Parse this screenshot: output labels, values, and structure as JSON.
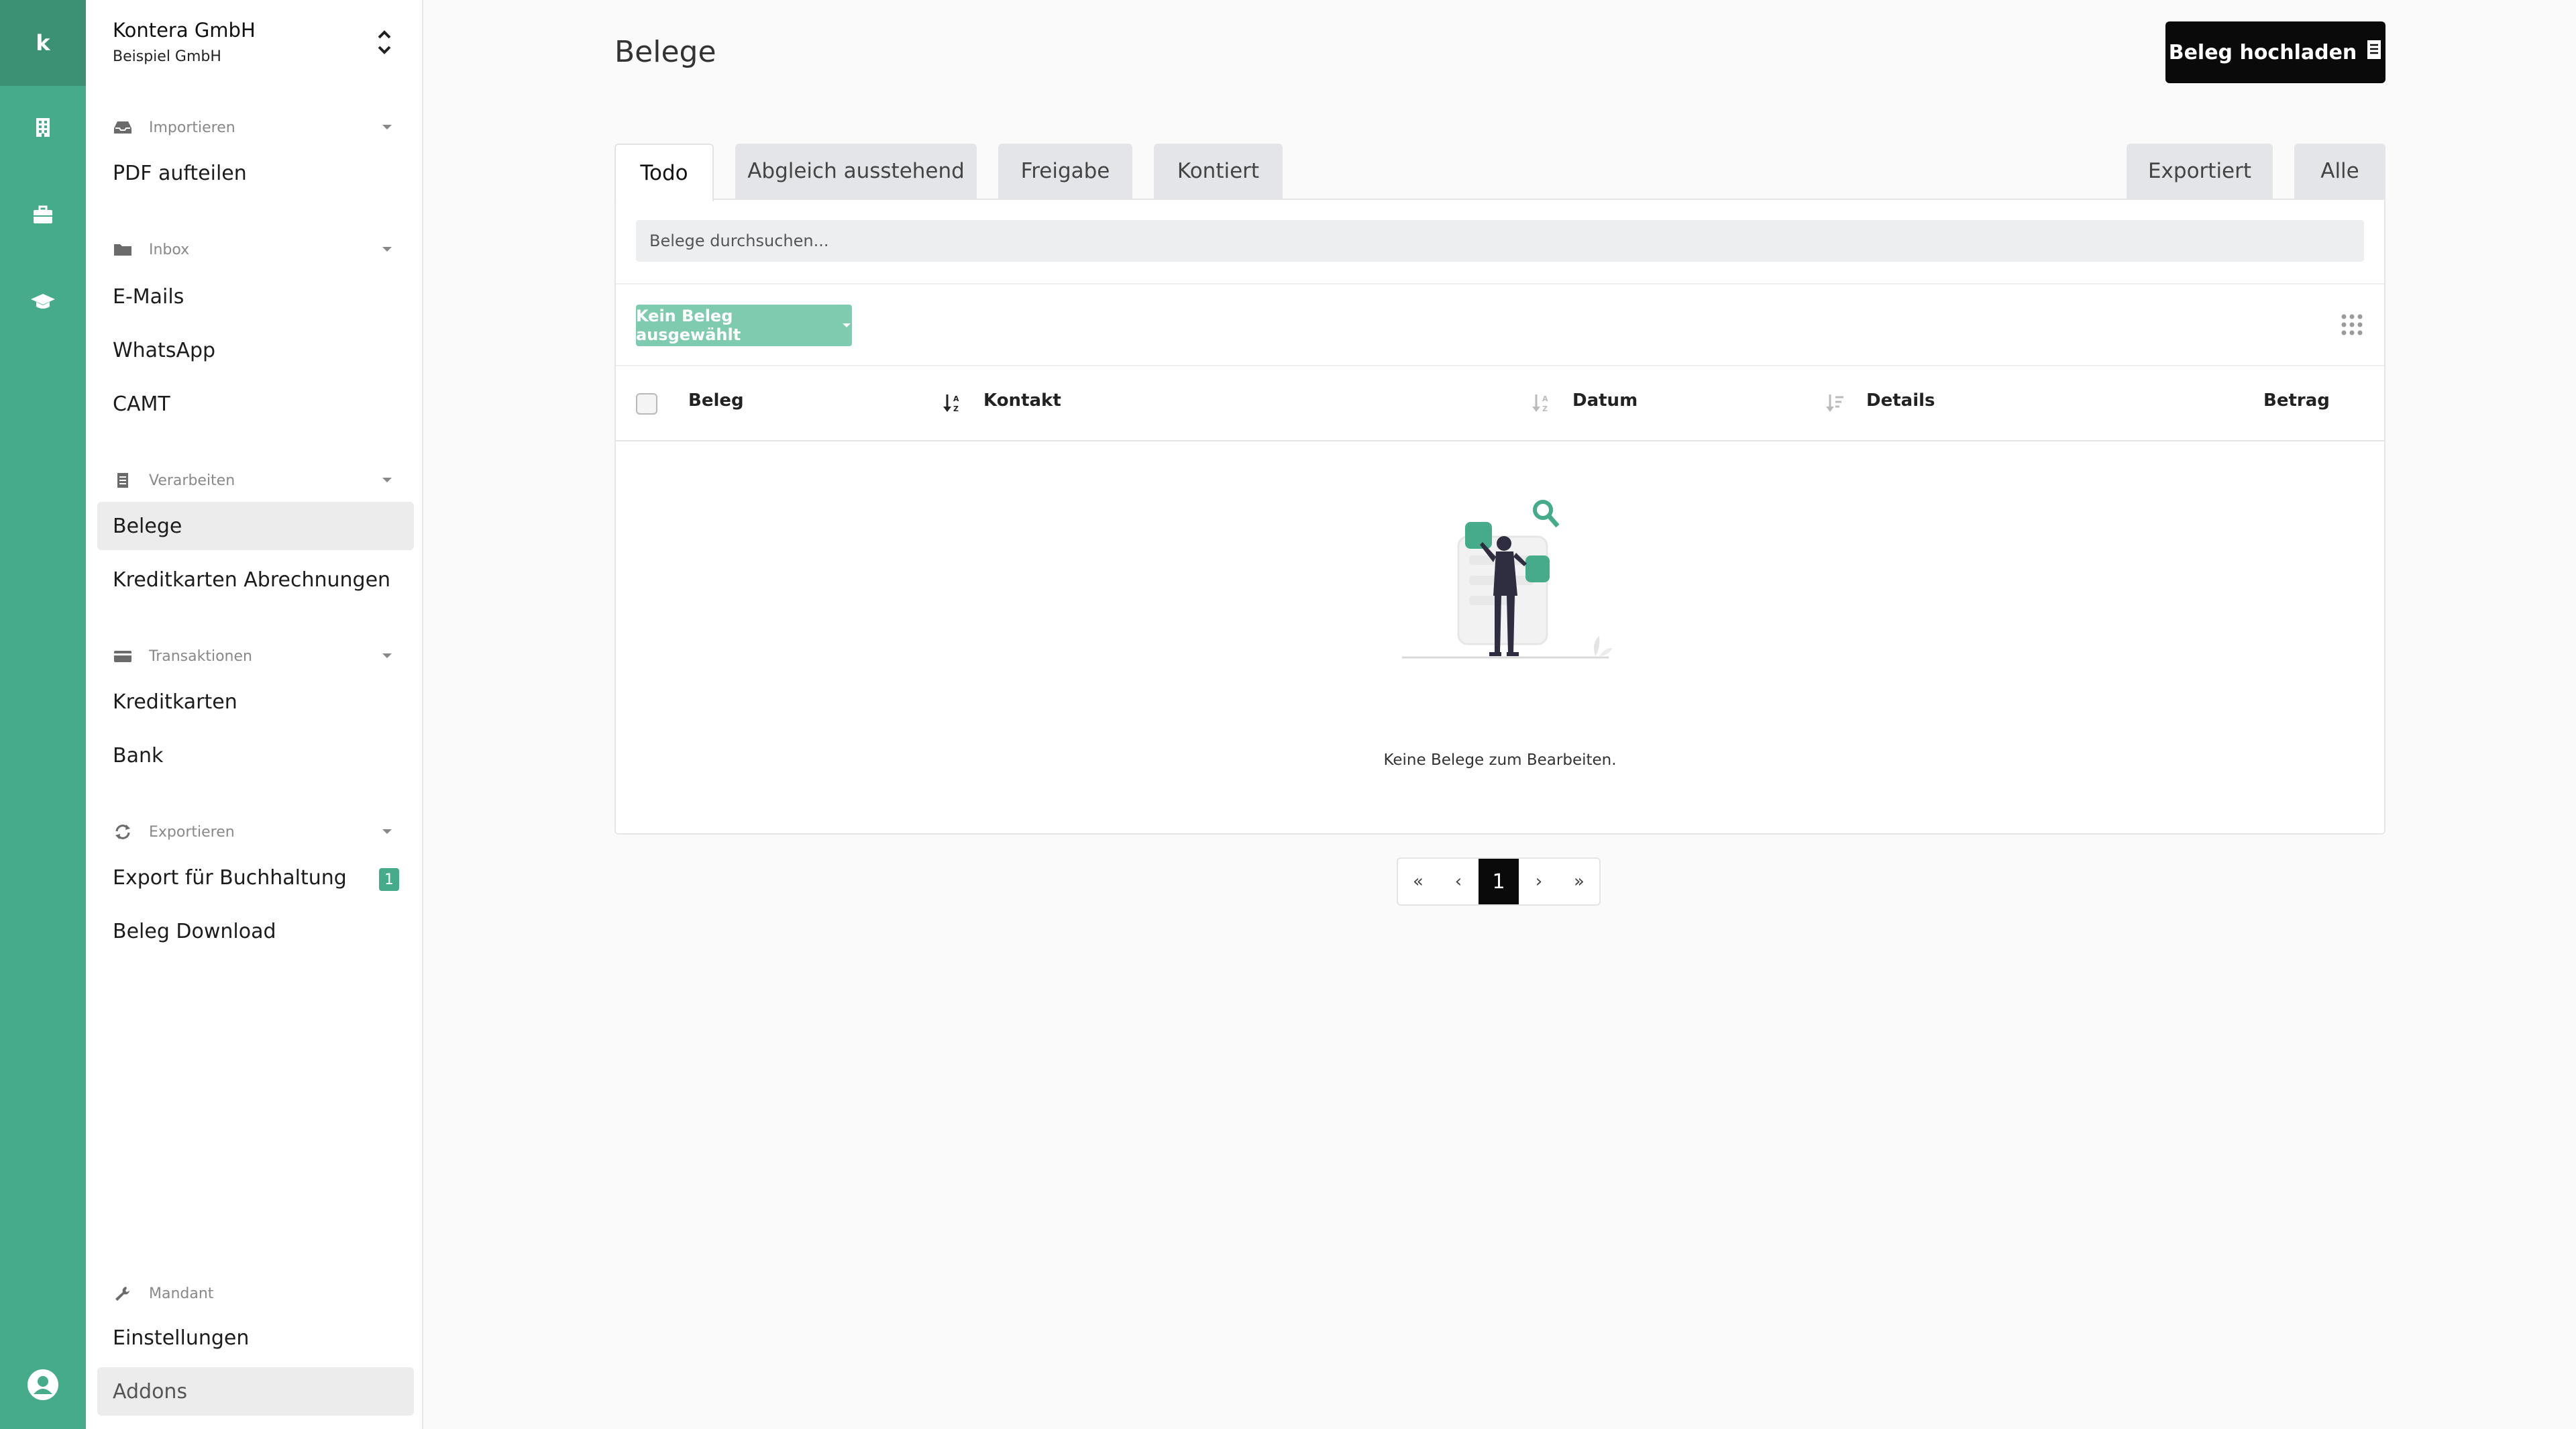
{
  "rail": {
    "logo": "k",
    "icons": [
      "building-icon",
      "briefcase-icon",
      "graduation-cap-icon",
      "user-circle-icon"
    ]
  },
  "company": {
    "name": "Kontera GmbH",
    "sub": "Beispiel GmbH"
  },
  "sidebar": {
    "sections": [
      {
        "title": "Importieren",
        "icon": "inbox-tray-icon",
        "items": [
          "PDF aufteilen"
        ]
      },
      {
        "title": "Inbox",
        "icon": "folder-icon",
        "items": [
          "E-Mails",
          "WhatsApp",
          "CAMT"
        ]
      },
      {
        "title": "Verarbeiten",
        "icon": "receipt-icon",
        "items": [
          "Belege",
          "Kreditkarten Abrechnungen"
        ]
      },
      {
        "title": "Transaktionen",
        "icon": "credit-card-icon",
        "items": [
          "Kreditkarten",
          "Bank"
        ]
      },
      {
        "title": "Exportieren",
        "icon": "sync-icon",
        "items": [
          "Export für Buchhaltung",
          "Beleg Download"
        ]
      },
      {
        "title": "Mandant",
        "icon": "wrench-icon",
        "items": [
          "Einstellungen",
          "Addons"
        ]
      }
    ],
    "export_badge": "1",
    "active_item": "Belege"
  },
  "page": {
    "title": "Belege",
    "upload_label": "Beleg hochladen"
  },
  "tabs": {
    "left": [
      "Todo",
      "Abgleich ausstehend",
      "Freigabe",
      "Kontiert"
    ],
    "right": [
      "Exportiert",
      "Alle"
    ],
    "active": "Todo"
  },
  "search": {
    "placeholder": "Belege durchsuchen..."
  },
  "bulk": {
    "label": "Kein Beleg ausgewählt"
  },
  "table": {
    "columns": [
      "Beleg",
      "Kontakt",
      "Datum",
      "Details",
      "Betrag"
    ]
  },
  "empty": {
    "text": "Keine Belege zum Bearbeiten."
  },
  "pager": {
    "first": "«",
    "prev": "‹",
    "current": "1",
    "next": "›",
    "last": "»"
  },
  "colors": {
    "brand": "#45ab8a",
    "brand_dark": "#3a9173",
    "primary_button": "#0a0a0a"
  }
}
